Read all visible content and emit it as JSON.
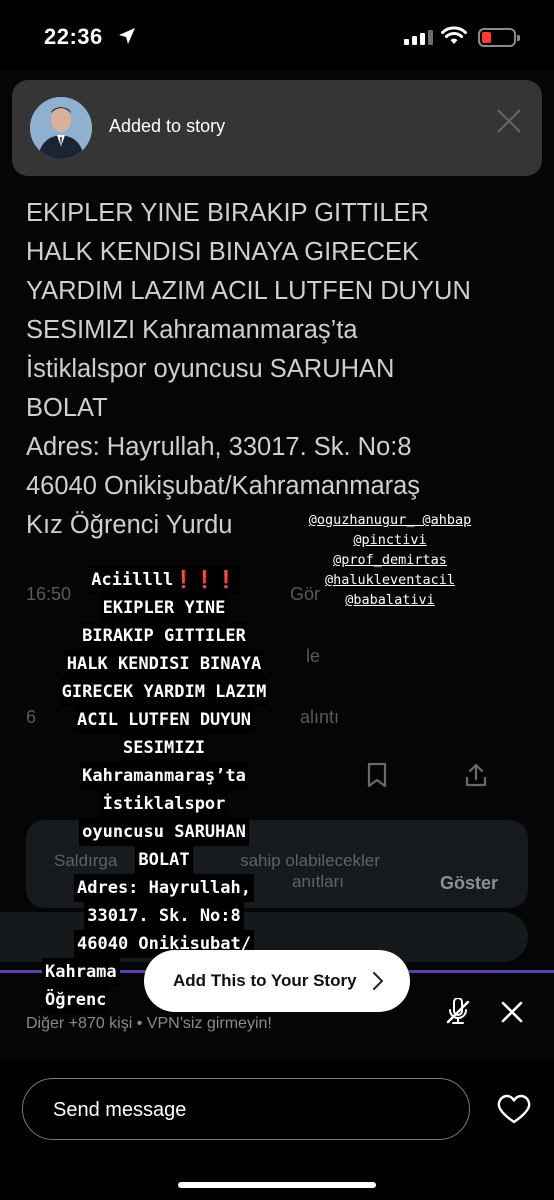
{
  "status_bar": {
    "time": "22:36"
  },
  "toast": {
    "label": "Added to story"
  },
  "tweet": {
    "lines": [
      "EKIPLER YINE BIRAKIP GITTILER",
      "HALK KENDISI BINAYA GIRECEK",
      "YARDIM LAZIM ACIL LUTFEN DUYUN",
      "SESIMIZI Kahramanmaraş’ta",
      "İstiklalspor oyuncusu SARUHAN",
      "BOLAT",
      "Adres: Hayrullah, 33017. Sk. No:8",
      "46040 Onikişubat/Kahramanmaraş",
      "Kız Öğrenci Yurdu"
    ],
    "time_fragment": "16:50",
    "views_fragment": "Gör",
    "faded_le": "le",
    "faded_6": "6",
    "faded_alinti": "alıntı",
    "warning_text_1": "Saldırga",
    "warning_text_1b": "sahip olabilecekler",
    "warning_text_2": "anıtları",
    "show_label": "Göster",
    "more_text": "Diğer +870 kişi • VPN’siz girmeyin!"
  },
  "mentions": [
    "@oguzhanugur_ @ahbap",
    "@pinctivi",
    "@prof_demirtas",
    "@halukleventacil",
    "@babalativi"
  ],
  "overlay": {
    "first_word": "Aciillll",
    "bangs": "❗❗❗",
    "lines": [
      "EKIPLER YINE",
      "BIRAKIP GITTILER",
      "HALK KENDISI BINAYA",
      "GIRECEK YARDIM LAZIM",
      "ACIL LUTFEN DUYUN",
      "SESIMIZI",
      "Kahramanmaraş’ta",
      "İstiklalspor",
      "oyuncusu SARUHAN",
      "BOLAT",
      "Adres: Hayrullah,",
      "33017. Sk. No:8",
      "46040 Onikisubat/",
      "Kahrama",
      "Öğrenc"
    ]
  },
  "add_story": {
    "label": "Add This to Your Story"
  },
  "send_message": {
    "placeholder": "Send message"
  },
  "colors": {
    "accent_purple": "#5b3fb3",
    "battery_red": "#ff3b30",
    "overlay_bang": "#e0242b"
  }
}
